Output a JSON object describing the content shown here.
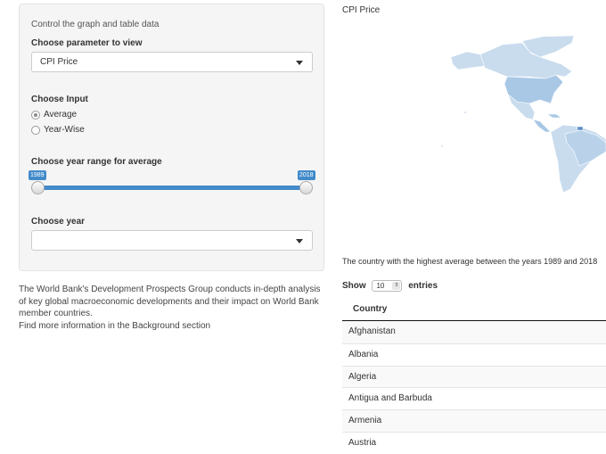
{
  "sidebar": {
    "panel_title": "Control the graph and table data",
    "parameter_label": "Choose parameter to view",
    "parameter_value": "CPI Price",
    "input_label": "Choose Input",
    "input_options": [
      {
        "label": "Average",
        "checked": true
      },
      {
        "label": "Year-Wise",
        "checked": false
      }
    ],
    "range_label": "Choose year range for average",
    "range_min": "1989",
    "range_max": "2018",
    "year_label": "Choose year",
    "year_value": "",
    "description_lines": [
      "The World Bank's Development Prospects Group conducts in-depth analysis of key global macroeconomic developments and their impact on World Bank member countries.",
      "Find more information in the Background section"
    ]
  },
  "main": {
    "map_title": "CPI Price",
    "map_colors": {
      "light": "#c9dcee",
      "mid": "#a9c8e6",
      "dark": "#5e8fc4"
    },
    "highest_text": "The country with the highest average between the years 1989 and 2018",
    "table": {
      "show_label": "Show",
      "page_length": "10",
      "entries_label": "entries",
      "column_header": "Country",
      "rows": [
        "Afghanistan",
        "Albania",
        "Algeria",
        "Antigua and Barbuda",
        "Armenia",
        "Austria"
      ]
    }
  },
  "colors": {
    "accent": "#428bca",
    "panel": "#f5f5f5"
  }
}
